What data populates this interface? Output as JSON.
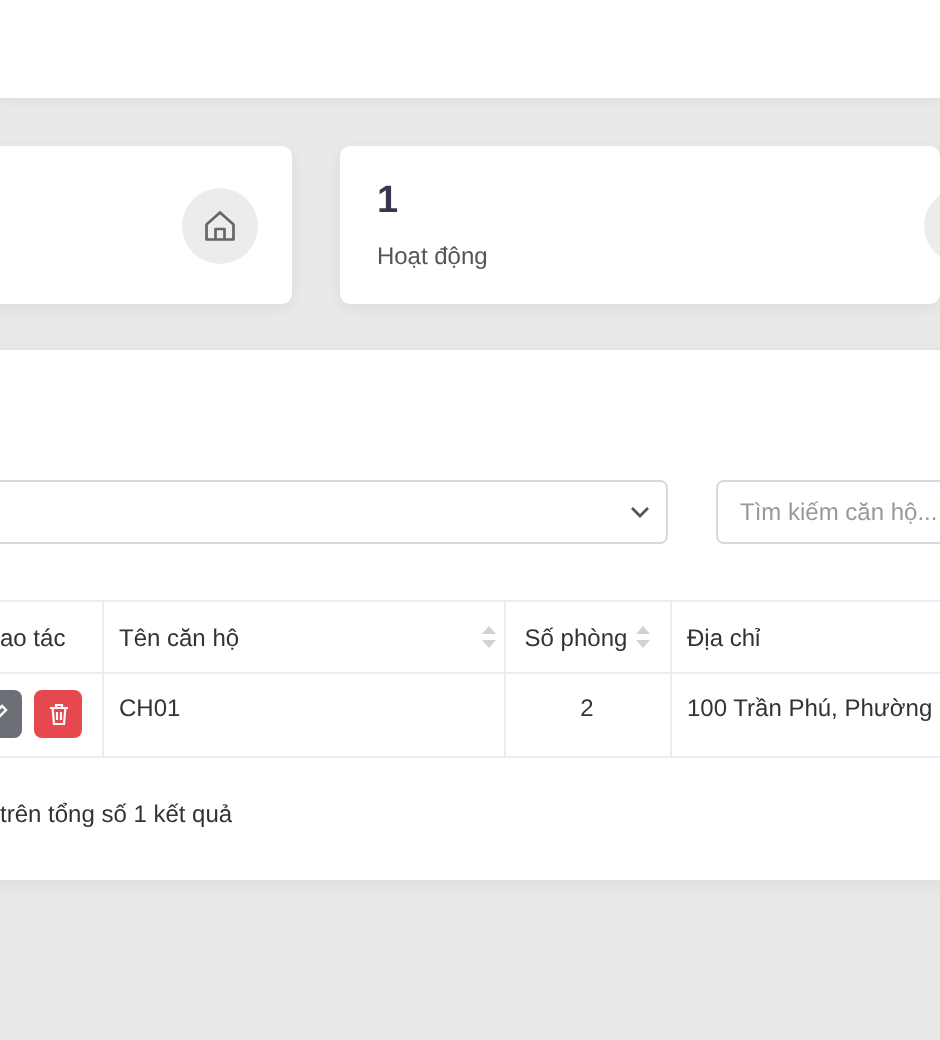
{
  "stat_cards": [
    {
      "value": "1",
      "label": "Hoạt động"
    }
  ],
  "filter": {
    "search_placeholder": "Tìm kiếm căn hộ..."
  },
  "table": {
    "columns": [
      {
        "label": "ao tác",
        "sortable": false
      },
      {
        "label": "Tên căn hộ",
        "sortable": true
      },
      {
        "label": "Số phòng",
        "sortable": true
      },
      {
        "label": "Địa chỉ",
        "sortable": false
      }
    ],
    "rows": [
      {
        "name": "CH01",
        "rooms": "2",
        "address": "100 Trần Phú, Phường"
      }
    ]
  },
  "footer": "trên tổng số 1 kết quả"
}
